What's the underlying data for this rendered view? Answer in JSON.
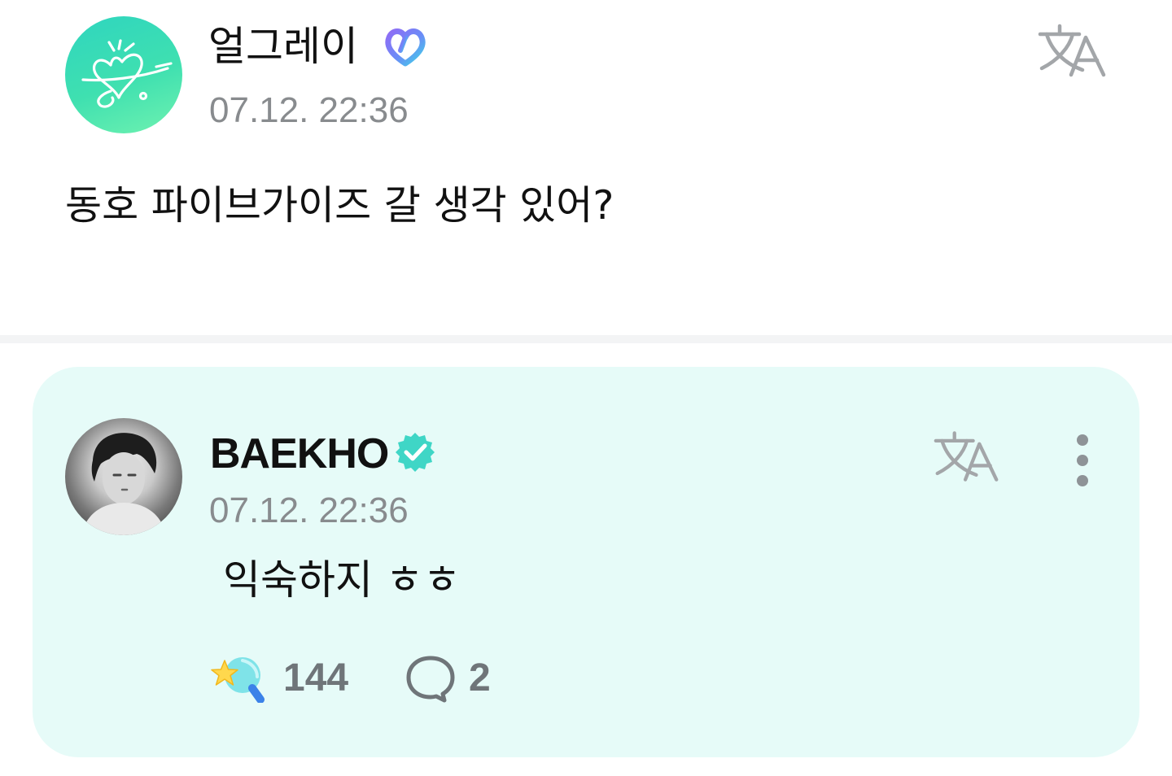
{
  "post": {
    "author": "얼그레이",
    "author_badge_icon": "weverse-heart-badge-icon",
    "timestamp": "07.12. 22:36",
    "content": "동호 파이브가이즈 갈 생각 있어?",
    "translate_icon": "translate-icon"
  },
  "reply": {
    "author": "BAEKHO",
    "author_badge_icon": "verified-check-icon",
    "timestamp": "07.12. 22:36",
    "content": "익숙하지 ㅎㅎ",
    "translate_icon": "translate-icon",
    "more_icon": "more-vertical-icon",
    "like_icon": "lightstick-star-icon",
    "like_count": "144",
    "comment_icon": "comment-bubble-icon",
    "comment_count": "2"
  },
  "colors": {
    "reply_background": "#e6fbf8",
    "divider": "#f3f4f5",
    "secondary_text": "#888b8e",
    "verified_badge": "#3fd6c6",
    "fan_avatar": "#2fd5bf"
  }
}
